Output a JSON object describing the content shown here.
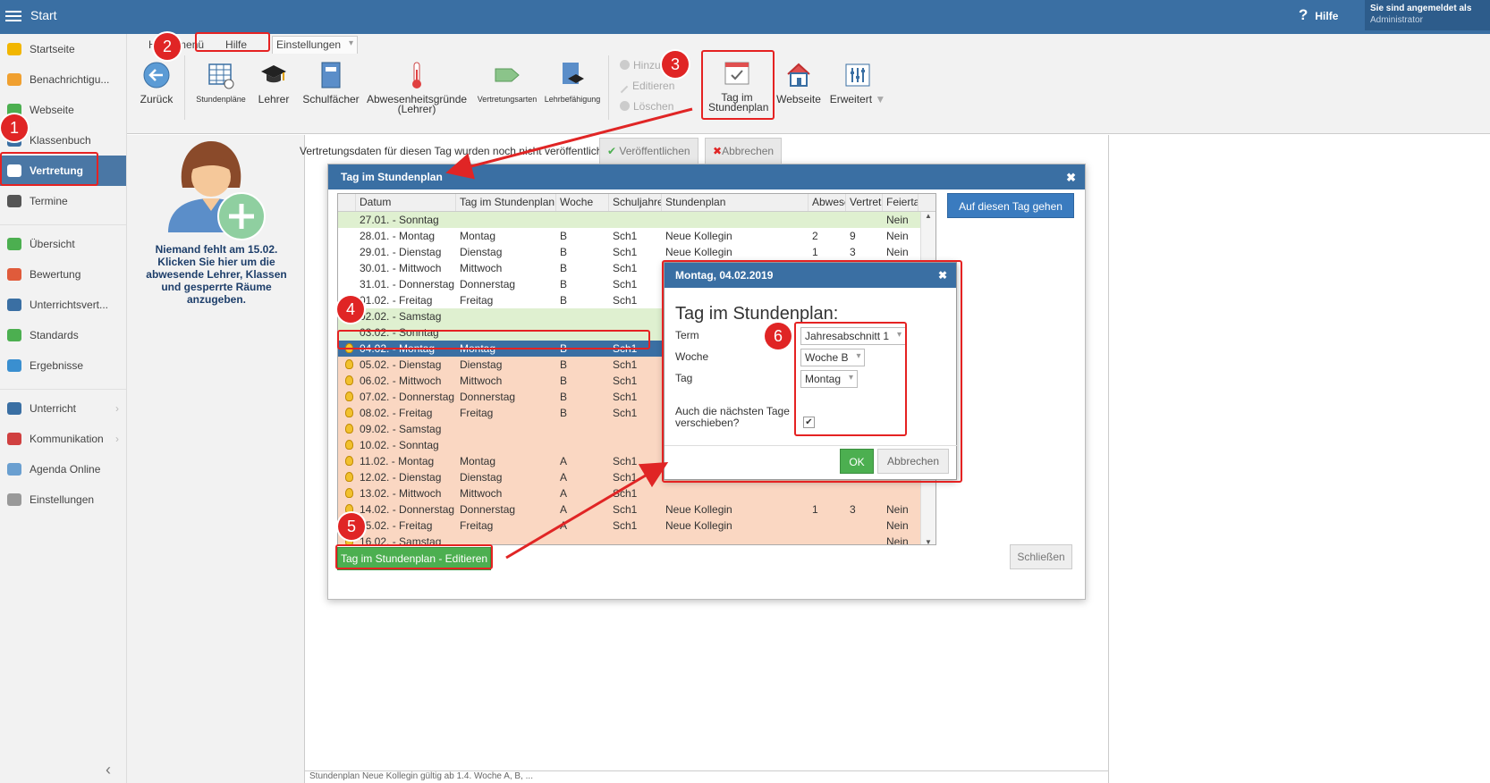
{
  "topbar": {
    "title": "Start",
    "help": "Hilfe",
    "user_line1": "Sie sind angemeldet als",
    "user_line2": "Administrator"
  },
  "sidebar": {
    "items": [
      {
        "label": "Startseite",
        "icon": "star-icon",
        "color": "#f2b600"
      },
      {
        "label": "Benachrichtigu...",
        "icon": "mail-icon",
        "color": "#f0a030"
      },
      {
        "label": "Webseite",
        "icon": "house-icon",
        "color": "#4caf50"
      },
      {
        "label": "Klassenbuch",
        "icon": "book-icon",
        "color": "#3a6fa3"
      },
      {
        "label": "Vertretung",
        "icon": "user-icon",
        "color": "#ffffff"
      },
      {
        "label": "Termine",
        "icon": "calendar-icon",
        "color": "#555555"
      },
      {
        "label": "Übersicht",
        "icon": "check-circle-icon",
        "color": "#4caf50"
      },
      {
        "label": "Bewertung",
        "icon": "gauge-icon",
        "color": "#e05b3b"
      },
      {
        "label": "Unterrichtsvert...",
        "icon": "ruler-icon",
        "color": "#3a6fa3"
      },
      {
        "label": "Standards",
        "icon": "shield-icon",
        "color": "#4caf50"
      },
      {
        "label": "Ergebnisse",
        "icon": "bar-chart-icon",
        "color": "#3a8fd0"
      },
      {
        "label": "Unterricht",
        "icon": "open-book-icon",
        "color": "#3a6fa3"
      },
      {
        "label": "Kommunikation",
        "icon": "chat-icon",
        "color": "#d04040"
      },
      {
        "label": "Agenda Online",
        "icon": "pen-icon",
        "color": "#6a9fd0"
      },
      {
        "label": "Einstellungen",
        "icon": "gear-icon",
        "color": "#999999"
      }
    ]
  },
  "ribbon": {
    "tabs": [
      "Hauptmenü",
      "Einstellungen",
      "Hilfe"
    ],
    "back": "Zurück",
    "buttons": [
      "Stundenpläne",
      "Lehrer",
      "Schulfächer",
      "Abwesenheitsgründe (Lehrer)",
      "Vertretungsarten",
      "Lehrbefähigung"
    ],
    "mini": [
      "Hinzu...",
      "Editieren",
      "Löschen"
    ],
    "tag_im_stundenplan": "Tag im Stundenplan",
    "webseite": "Webseite",
    "erweitert": "Erweitert"
  },
  "left": {
    "nobody": "Niemand fehlt am 15.02. Klicken Sie hier um die abwesende Lehrer, Klassen und gesperrte Räume anzugeben."
  },
  "main": {
    "info": "Vertretungsdaten für diesen Tag wurden noch nicht veröffentlicht.",
    "publish": "Veröffentlichen",
    "cancel": "Abbrechen",
    "status": "Stundenplan Neue Kollegin gültig ab 1.4. Woche A, B, ..."
  },
  "dialog": {
    "title": "Tag im Stundenplan",
    "columns": [
      "Datum",
      "Tag im Stundenplan",
      "Woche",
      "Schuljahres",
      "Stundenplan",
      "Abwese",
      "Vertretu",
      "Feiertag"
    ],
    "rows": [
      {
        "c": [
          "27.01. - Sonntag",
          "",
          "",
          "",
          "",
          "",
          "",
          "Nein"
        ],
        "t": "g"
      },
      {
        "c": [
          "28.01. - Montag",
          "Montag",
          "B",
          "Sch1",
          "Neue Kollegin",
          "2",
          "9",
          "Nein"
        ],
        "t": "w"
      },
      {
        "c": [
          "29.01. - Dienstag",
          "Dienstag",
          "B",
          "Sch1",
          "Neue Kollegin",
          "1",
          "3",
          "Nein"
        ],
        "t": "w"
      },
      {
        "c": [
          "30.01. - Mittwoch",
          "Mittwoch",
          "B",
          "Sch1",
          "",
          "",
          "",
          ""
        ],
        "t": "w"
      },
      {
        "c": [
          "31.01. - Donnerstag",
          "Donnerstag",
          "B",
          "Sch1",
          "",
          "",
          "",
          ""
        ],
        "t": "w"
      },
      {
        "c": [
          "01.02. - Freitag",
          "Freitag",
          "B",
          "Sch1",
          "",
          "",
          "",
          ""
        ],
        "t": "w"
      },
      {
        "c": [
          "02.02. - Samstag",
          "",
          "",
          "",
          "",
          "",
          "",
          ""
        ],
        "t": "g"
      },
      {
        "c": [
          "03.02. - Sonntag",
          "",
          "",
          "",
          "",
          "",
          "",
          ""
        ],
        "t": "g"
      },
      {
        "c": [
          "04.02. - Montag",
          "Montag",
          "B",
          "Sch1",
          "",
          "",
          "",
          ""
        ],
        "t": "s",
        "b": true
      },
      {
        "c": [
          "05.02. - Dienstag",
          "Dienstag",
          "B",
          "Sch1",
          "",
          "",
          "",
          ""
        ],
        "t": "o",
        "b": true
      },
      {
        "c": [
          "06.02. - Mittwoch",
          "Mittwoch",
          "B",
          "Sch1",
          "",
          "",
          "",
          ""
        ],
        "t": "o",
        "b": true
      },
      {
        "c": [
          "07.02. - Donnerstag",
          "Donnerstag",
          "B",
          "Sch1",
          "",
          "",
          "",
          ""
        ],
        "t": "o",
        "b": true
      },
      {
        "c": [
          "08.02. - Freitag",
          "Freitag",
          "B",
          "Sch1",
          "",
          "",
          "",
          ""
        ],
        "t": "o",
        "b": true
      },
      {
        "c": [
          "09.02. - Samstag",
          "",
          "",
          "",
          "",
          "",
          "",
          ""
        ],
        "t": "o",
        "b": true
      },
      {
        "c": [
          "10.02. - Sonntag",
          "",
          "",
          "",
          "",
          "",
          "",
          ""
        ],
        "t": "o",
        "b": true
      },
      {
        "c": [
          "11.02. - Montag",
          "Montag",
          "A",
          "Sch1",
          "",
          "",
          "",
          ""
        ],
        "t": "o",
        "b": true
      },
      {
        "c": [
          "12.02. - Dienstag",
          "Dienstag",
          "A",
          "Sch1",
          "",
          "",
          "",
          ""
        ],
        "t": "o",
        "b": true
      },
      {
        "c": [
          "13.02. - Mittwoch",
          "Mittwoch",
          "A",
          "Sch1",
          "",
          "",
          "",
          ""
        ],
        "t": "o",
        "b": true
      },
      {
        "c": [
          "14.02. - Donnerstag",
          "Donnerstag",
          "A",
          "Sch1",
          "Neue Kollegin",
          "1",
          "3",
          "Nein"
        ],
        "t": "o",
        "b": true
      },
      {
        "c": [
          "15.02. - Freitag",
          "Freitag",
          "A",
          "Sch1",
          "Neue Kollegin",
          "",
          "",
          "Nein"
        ],
        "t": "o",
        "b": true
      },
      {
        "c": [
          "16.02. - Samstag",
          "",
          "",
          "",
          "",
          "",
          "",
          "Nein"
        ],
        "t": "o",
        "b": true
      }
    ],
    "go_button": "Auf diesen Tag gehen",
    "edit_button": "Tag im Stundenplan - Editieren",
    "close_button": "Schließen"
  },
  "subdialog": {
    "title": "Montag, 04.02.2019",
    "heading": "Tag im Stundenplan:",
    "term_label": "Term",
    "term_value": "Jahresabschnitt 1",
    "week_label": "Woche",
    "week_value": "Woche B",
    "day_label": "Tag",
    "day_value": "Montag",
    "shift_label": "Auch die nächsten Tage verschieben?",
    "ok": "OK",
    "cancel": "Abbrechen"
  },
  "badges": [
    "1",
    "2",
    "3",
    "4",
    "5",
    "6"
  ]
}
